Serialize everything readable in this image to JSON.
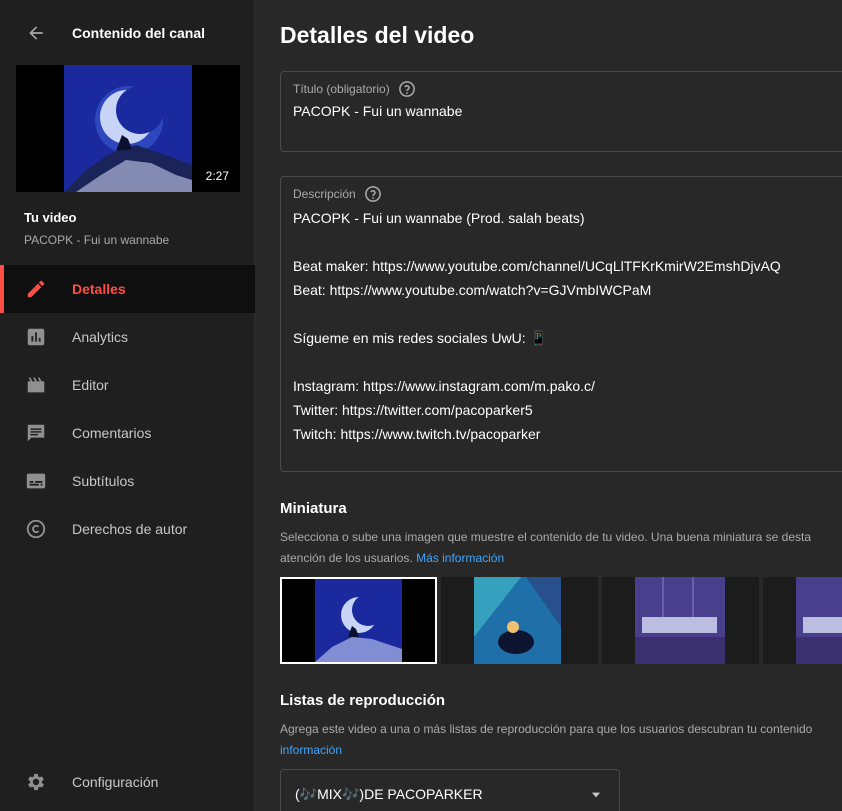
{
  "sidebar": {
    "header_title": "Contenido del canal",
    "video_duration": "2:27",
    "your_video_label": "Tu video",
    "video_title": "PACOPK - Fui un wannabe",
    "nav": [
      {
        "label": "Detalles",
        "icon": "pencil-icon",
        "active": true
      },
      {
        "label": "Analytics",
        "icon": "analytics-icon",
        "active": false
      },
      {
        "label": "Editor",
        "icon": "clapperboard-icon",
        "active": false
      },
      {
        "label": "Comentarios",
        "icon": "comment-icon",
        "active": false
      },
      {
        "label": "Subtítulos",
        "icon": "subtitles-icon",
        "active": false
      },
      {
        "label": "Derechos de autor",
        "icon": "copyright-icon",
        "active": false
      }
    ],
    "settings_label": "Configuración"
  },
  "main": {
    "page_title": "Detalles del video",
    "title_field": {
      "label": "Título (obligatorio)",
      "value": "PACOPK - Fui un wannabe"
    },
    "description_field": {
      "label": "Descripción",
      "lines": [
        "PACOPK - Fui un wannabe (Prod. salah beats)",
        "",
        "Beat maker: https://www.youtube.com/channel/UCqLlTFKrKmirW2EmshDjvAQ",
        "Beat: https://www.youtube.com/watch?v=GJVmbIWCPaM",
        "",
        "Sígueme en mis redes sociales UwU: 📱",
        "",
        "Instagram: https://www.instagram.com/m.pako.c/",
        "Twitter: https://twitter.com/pacoparker5",
        "Twitch: https://www.twitch.tv/pacoparker"
      ]
    },
    "thumbnail_section": {
      "title": "Miniatura",
      "text_line1": "Selecciona o sube una imagen que muestre el contenido de tu video. Una buena miniatura se desta",
      "text_line2": "atención de los usuarios.",
      "link": "Más información"
    },
    "playlists_section": {
      "title": "Listas de reproducción",
      "text_line1": "Agrega este video a una o más listas de reproducción para que los usuarios descubran tu contenido",
      "link": "información",
      "selected_value": "(🎶MIX🎶)DE PACOPARKER"
    }
  },
  "colors": {
    "accent": "#ff4e45",
    "link": "#3ea6ff",
    "sidebar_bg": "#1f1f1f",
    "main_bg": "#282828"
  }
}
